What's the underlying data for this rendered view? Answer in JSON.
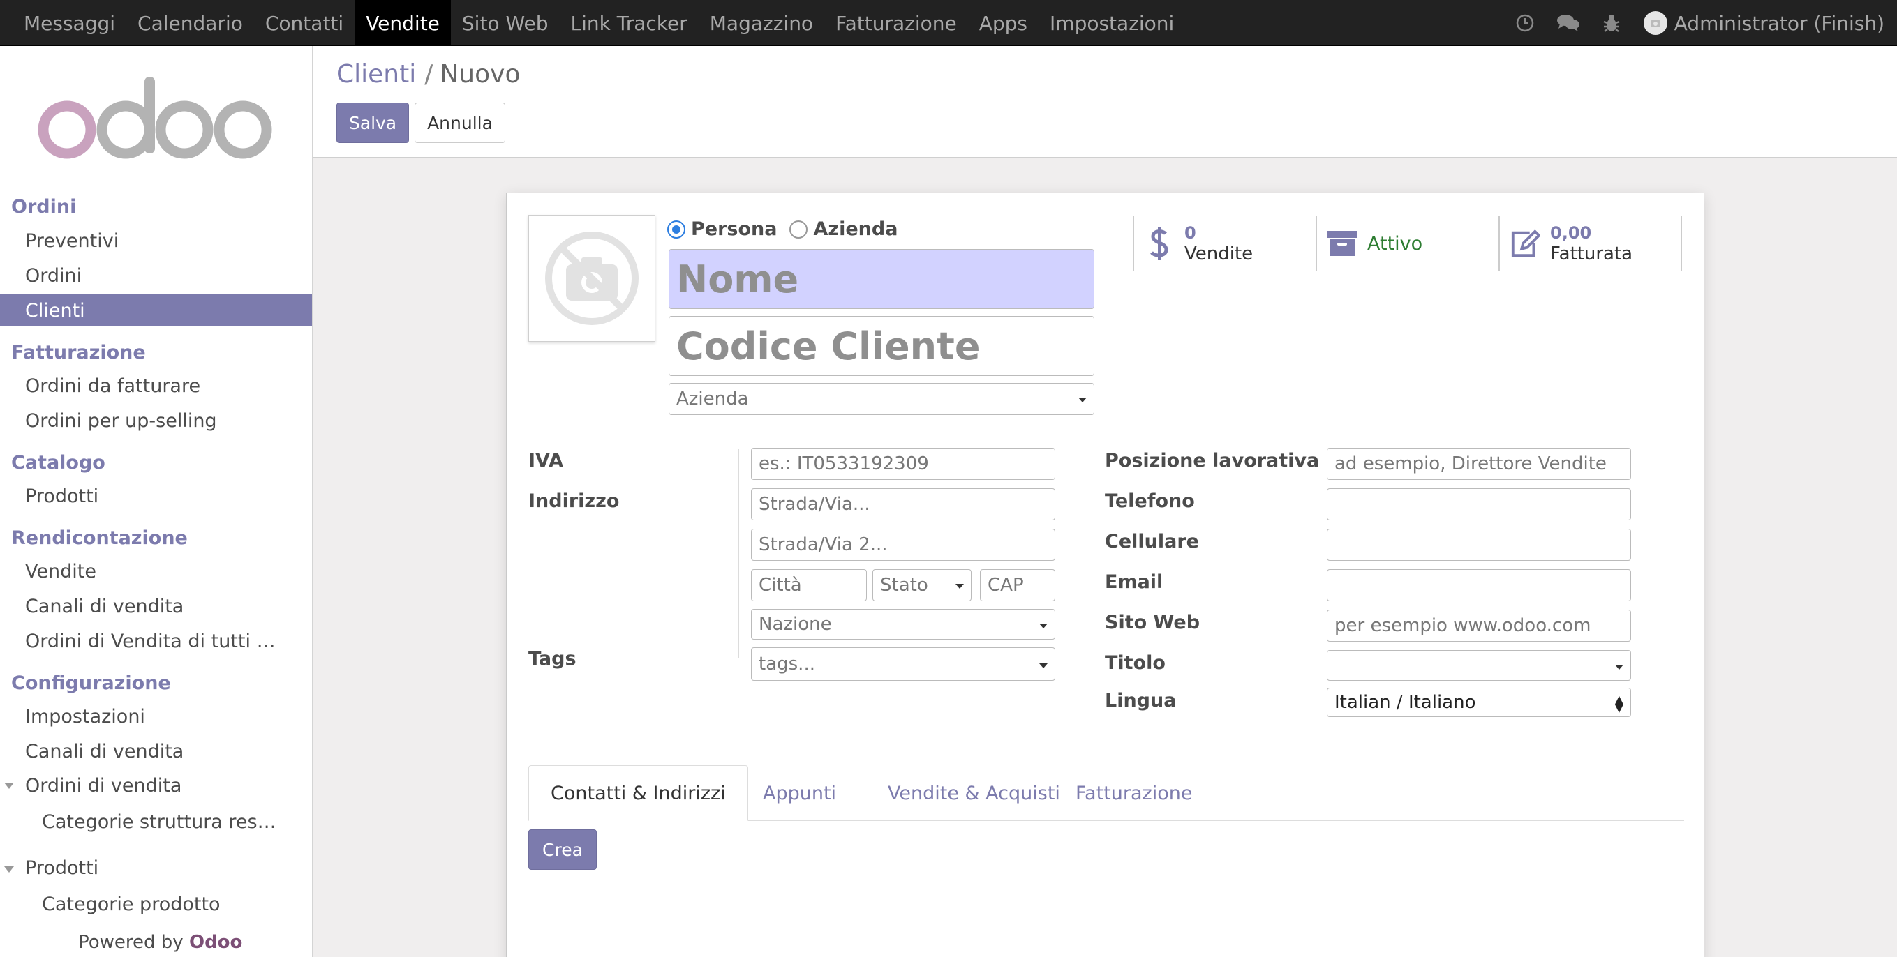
{
  "topbar": {
    "menu": [
      {
        "label": "Messaggi"
      },
      {
        "label": "Calendario"
      },
      {
        "label": "Contatti"
      },
      {
        "label": "Vendite",
        "active": true
      },
      {
        "label": "Sito Web"
      },
      {
        "label": "Link Tracker"
      },
      {
        "label": "Magazzino"
      },
      {
        "label": "Fatturazione"
      },
      {
        "label": "Apps"
      },
      {
        "label": "Impostazioni"
      }
    ],
    "icons": [
      "clock-icon",
      "chat-icon",
      "bug-icon"
    ],
    "user": "Administrator (Finish)"
  },
  "sidebar": {
    "logo": "odoo",
    "sections": [
      {
        "title": "Ordini",
        "items": [
          "Preventivi",
          "Ordini",
          "Clienti"
        ]
      },
      {
        "title": "Fatturazione",
        "items": [
          "Ordini da fatturare",
          "Ordini per up-selling"
        ]
      },
      {
        "title": "Catalogo",
        "items": [
          "Prodotti"
        ]
      },
      {
        "title": "Rendicontazione",
        "items": [
          "Vendite",
          "Canali di vendita",
          "Ordini di Vendita di tutti …"
        ]
      },
      {
        "title": "Configurazione",
        "items": [
          "Impostazioni",
          "Canali di vendita",
          "Ordini di vendita",
          "Categorie struttura res…",
          "Prodotti",
          "Categorie prodotto"
        ]
      }
    ],
    "active_item": "Clienti",
    "powered_by": "Powered by",
    "powered_brand": "Odoo"
  },
  "control_panel": {
    "breadcrumb_parent": "Clienti",
    "breadcrumb_separator": "/",
    "breadcrumb_current": "Nuovo",
    "save_label": "Salva",
    "discard_label": "Annulla"
  },
  "form": {
    "company_type": {
      "person": "Persona",
      "company": "Azienda",
      "selected": "Persona"
    },
    "name_placeholder": "Nome",
    "customer_code_placeholder": "Codice Cliente",
    "company_placeholder": "Azienda",
    "smart_buttons": [
      {
        "value": "0",
        "label": "Vendite",
        "icon": "dollar-icon"
      },
      {
        "label": "Attivo",
        "icon": "archive-icon"
      },
      {
        "value": "0,00",
        "label": "Fatturata",
        "icon": "edit-icon"
      }
    ],
    "left_labels": {
      "vat": "IVA",
      "address": "Indirizzo",
      "tags": "Tags"
    },
    "vat_placeholder": "es.: IT0533192309",
    "street_placeholder": "Strada/Via...",
    "street2_placeholder": "Strada/Via 2...",
    "city_placeholder": "Città",
    "state_placeholder": "Stato",
    "zip_placeholder": "CAP",
    "country_placeholder": "Nazione",
    "tags_placeholder": "tags...",
    "right_labels": {
      "function": "Posizione lavorativa",
      "phone": "Telefono",
      "mobile": "Cellulare",
      "email": "Email",
      "website": "Sito Web",
      "title": "Titolo",
      "language": "Lingua"
    },
    "function_placeholder": "ad esempio, Direttore Vendite",
    "website_placeholder": "per esempio www.odoo.com",
    "language_value": "Italian / Italiano",
    "tabs": [
      "Contatti & Indirizzi",
      "Appunti",
      "Vendite & Acquisti",
      "Fatturazione"
    ],
    "active_tab": "Contatti & Indirizzi",
    "create_label": "Crea"
  },
  "colors": {
    "brand": "#7c7bad",
    "topbar": "#222222",
    "required_field": "#d2d2ff",
    "active_green": "#2e7d32"
  }
}
